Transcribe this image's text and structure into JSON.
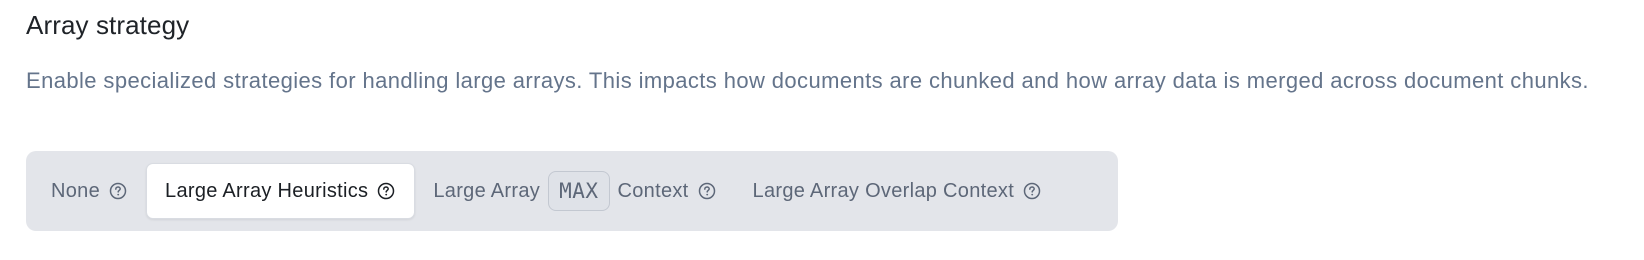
{
  "section": {
    "title": "Array strategy",
    "description": "Enable specialized strategies for handling large arrays. This impacts how documents are chunked and how array data is merged across document chunks."
  },
  "strategy_options": [
    {
      "label": "None",
      "selected": false,
      "icon": "help-circle-icon"
    },
    {
      "label": "Large Array Heuristics",
      "selected": true,
      "icon": "help-circle-icon"
    },
    {
      "label_before": "Large Array",
      "badge": "MAX",
      "label_after": "Context",
      "selected": false,
      "icon": "help-circle-icon"
    },
    {
      "label": "Large Array Overlap Context",
      "selected": false,
      "icon": "help-circle-icon"
    }
  ],
  "colors": {
    "segment_background": "#e3e5ea",
    "selected_background": "#ffffff",
    "muted_text": "#5d6778",
    "description_text": "#64748b",
    "title_text": "#1f2328"
  }
}
